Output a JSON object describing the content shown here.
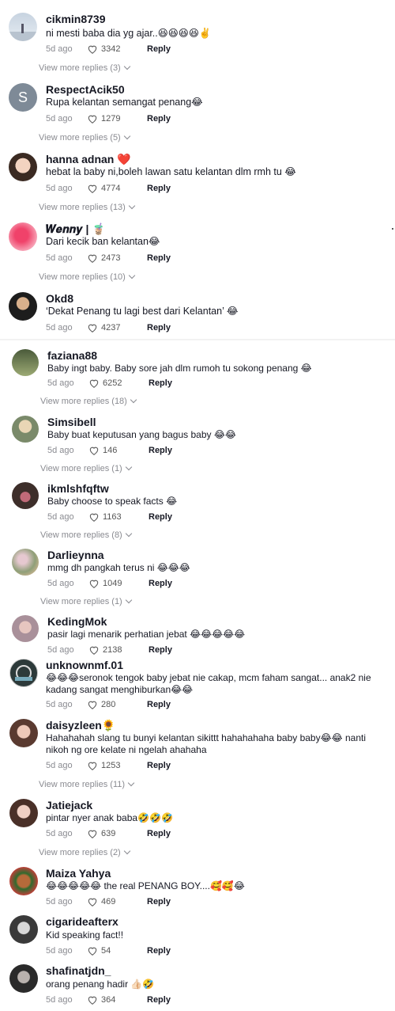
{
  "comments": [
    {
      "username": "cikmin8739",
      "text": "ni mesti baba dia yg ajar..😆😆😆😆✌️",
      "age": "5d ago",
      "likes": "3342",
      "reply": "Reply",
      "more": "View more replies (3)"
    },
    {
      "username": "RespectAcik50",
      "text": "Rupa kelantan semangat penang😂",
      "age": "5d ago",
      "likes": "1279",
      "reply": "Reply",
      "more": "View more replies (5)",
      "avatar_letter": "S"
    },
    {
      "username": "hanna adnan ❤️",
      "text": "hebat la baby ni,boleh lawan satu kelantan dlm rmh tu 😂",
      "age": "5d ago",
      "likes": "4774",
      "reply": "Reply",
      "more": "View more replies (13)"
    },
    {
      "username": "𝑾𝒆𝒏𝒏𝒚 | 🧋",
      "text": "Dari kecik ban kelantan😂",
      "age": "5d ago",
      "likes": "2473",
      "reply": "Reply",
      "more": "View more replies (10)"
    },
    {
      "username": "Okd8",
      "text": "‘Dekat Penang tu lagi best dari Kelantan’ 😂",
      "age": "5d ago",
      "likes": "4237",
      "reply": "Reply"
    },
    {
      "username": "faziana88",
      "text": "Baby ingt baby. Baby sore jah dlm rumoh tu sokong penang 😂",
      "age": "5d ago",
      "likes": "6252",
      "reply": "Reply",
      "more": "View more replies (18)"
    },
    {
      "username": "Simsibell",
      "text": "Baby buat keputusan yang bagus baby 😂😂",
      "age": "5d ago",
      "likes": "146",
      "reply": "Reply",
      "more": "View more replies (1)"
    },
    {
      "username": "ikmlshfqftw",
      "text": "Baby choose to speak facts 😂",
      "age": "5d ago",
      "likes": "1163",
      "reply": "Reply",
      "more": "View more replies (8)"
    },
    {
      "username": "Darlieynna",
      "text": "mmg dh pangkah terus ni 😂😂😂",
      "age": "5d ago",
      "likes": "1049",
      "reply": "Reply",
      "more": "View more replies (1)"
    },
    {
      "username": "KedingMok",
      "text": "pasir lagi menarik perhatian jebat 😂😂😂😂😂",
      "age": "5d ago",
      "likes": "2138",
      "reply": "Reply"
    },
    {
      "username": "unknownmf.01",
      "text": "😂😂😂seronok tengok baby jebat nie cakap, mcm faham sangat... anak2 nie",
      "text2": "kadang sangat menghiburkan😂😂",
      "age": "5d ago",
      "likes": "280",
      "reply": "Reply"
    },
    {
      "username": "daisyzleen🌻",
      "text": "Hahahahah slang tu bunyi kelantan sikittt hahahahaha baby baby😂😂 nanti",
      "text2": "nikoh ng ore kelate ni ngelah ahahaha",
      "age": "5d ago",
      "likes": "1253",
      "reply": "Reply",
      "more": "View more replies (11)"
    },
    {
      "username": "Jatiejack",
      "text": "pintar nyer anak baba🤣🤣🤣",
      "age": "5d ago",
      "likes": "639",
      "reply": "Reply",
      "more": "View more replies (2)"
    },
    {
      "username": "Maiza Yahya",
      "text": "😂😂😂😂😂 the real PENANG BOY....🥰🥰😂",
      "age": "5d ago",
      "likes": "469",
      "reply": "Reply"
    },
    {
      "username": "cigarideafterx",
      "text": "Kid speaking fact!!",
      "age": "5d ago",
      "likes": "54",
      "reply": "Reply"
    },
    {
      "username": "shafinatjdn_",
      "text": "orang penang hadir 👍🏻🤣",
      "age": "5d ago",
      "likes": "364",
      "reply": "Reply"
    }
  ],
  "icons": {
    "like": "heart-outline-icon",
    "expand": "chevron-down-icon"
  },
  "colors": {
    "text": "#161823",
    "secondary": "#8a8b91",
    "background": "#ffffff"
  }
}
